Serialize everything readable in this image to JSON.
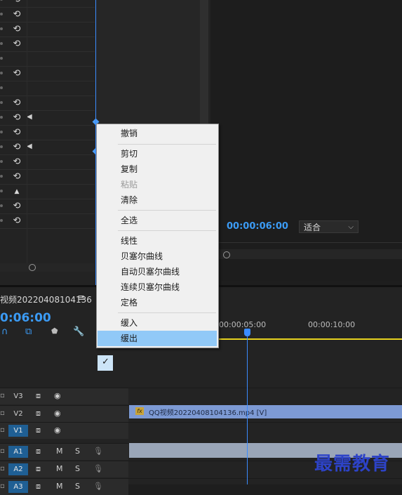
{
  "effect_controls": {
    "reset_glyph": "⟲",
    "rows": [
      {
        "reset": true
      },
      {
        "reset": true
      },
      {
        "reset": true
      },
      {
        "reset": true
      },
      {
        "reset": false
      },
      {
        "reset": true
      },
      {
        "reset": false
      },
      {
        "reset": true
      },
      {
        "reset": true,
        "keyframe_nav": true
      },
      {
        "reset": true
      },
      {
        "reset": true,
        "keyframe_nav": true
      },
      {
        "reset": true
      },
      {
        "reset": true
      },
      {
        "reset": false,
        "collapse": true
      },
      {
        "reset": true
      },
      {
        "reset": true
      }
    ]
  },
  "program_monitor": {
    "timecode": "00:00:06:00",
    "fit_label": "适合"
  },
  "timeline": {
    "sequence_title": "视频20220408104136",
    "timecode": "0:06:00",
    "ruler_labels": [
      "00:00:05:00",
      "00:00:10:00"
    ],
    "tracks": [
      {
        "label": "V3",
        "active": false,
        "kind": "video"
      },
      {
        "label": "V2",
        "active": false,
        "kind": "video"
      },
      {
        "label": "V1",
        "active": true,
        "kind": "video"
      },
      {
        "label": "A1",
        "active": true,
        "kind": "audio"
      },
      {
        "label": "A2",
        "active": true,
        "kind": "audio"
      },
      {
        "label": "A3",
        "active": true,
        "kind": "audio"
      }
    ],
    "video_clip_label": "QQ视频20220408104136.mp4 [V]",
    "fx_badge": "fx",
    "m_label": "M",
    "s_label": "S"
  },
  "context_menu": {
    "items": [
      "撤销",
      "剪切",
      "复制",
      "粘贴",
      "清除",
      "全选",
      "线性",
      "贝塞尔曲线",
      "自动贝塞尔曲线",
      "连续贝塞尔曲线",
      "定格",
      "缓入",
      "缓出"
    ],
    "disabled": [
      "粘贴"
    ],
    "checked": "线性",
    "highlighted": "缓出"
  },
  "watermark": "最需教育",
  "colors": {
    "accent_blue": "#3b9bf5",
    "menu_highlight": "#91c9f7",
    "work_area": "#e6d21f",
    "watermark": "#2d43c8"
  }
}
